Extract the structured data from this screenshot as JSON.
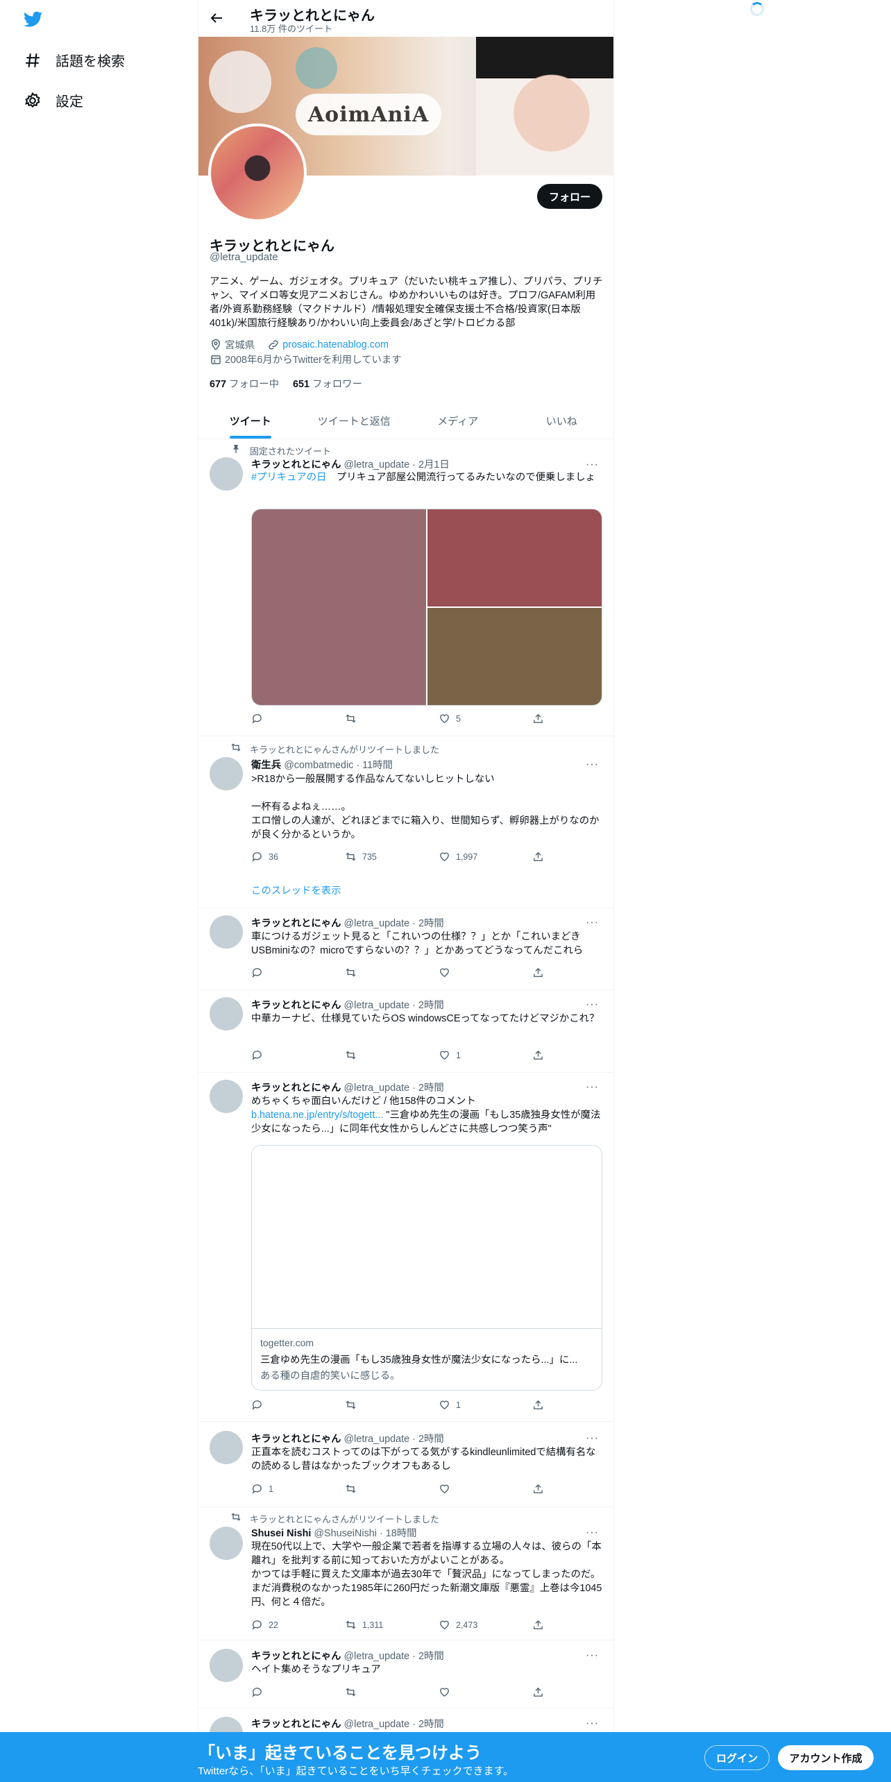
{
  "sidebar": {
    "items": [
      {
        "label": "話題を検索",
        "icon": "hashtag-icon"
      },
      {
        "label": "設定",
        "icon": "gear-icon"
      }
    ]
  },
  "header": {
    "name": "キラッとれとにゃん",
    "tweet_count": "11.8万 件のツイート"
  },
  "banner": {
    "logo_text": "AoimAniA"
  },
  "profile": {
    "follow_label": "フォロー",
    "name": "キラッとれとにゃん",
    "handle": "@letra_update",
    "bio": "アニメ、ゲーム、ガジェオタ。プリキュア（だいたい桃キュア推し）、プリパラ、プリチャン、マイメロ等女児アニメおじさん。ゆめかわいいものは好き。プロフ/GAFAM利用者/外資系勤務経験（マクドナルド）/情報処理安全確保支援士不合格/投資家(日本版401k)/米国旅行経験あり/かわいい向上委員会/あざと学/トロピカる部",
    "location": "宮城県",
    "url": "prosaic.hatenablog.com",
    "joined": "2008年6月からTwitterを利用しています",
    "following_count": "677",
    "following_label": "フォロー中",
    "followers_count": "651",
    "followers_label": "フォロワー"
  },
  "tabs": [
    {
      "label": "ツイート",
      "active": true
    },
    {
      "label": "ツイートと返信"
    },
    {
      "label": "メディア"
    },
    {
      "label": "いいね"
    }
  ],
  "tweets": [
    {
      "context": "固定されたツイート",
      "name": "キラッとれとにゃん",
      "handle": "@letra_update",
      "time": "2月1日",
      "hashtag": "#プリキュアの日",
      "text": "プリキュア部屋公開流行ってるみたいなので便乗しましょ",
      "reply": "",
      "retweet": "",
      "like": "5"
    },
    {
      "context": "キラッとれとにゃんさんがリツイートしました",
      "name": "衛生兵",
      "handle": "@combatmedic",
      "time": "11時間",
      "text": ">R18から一般展開する作品なんてないしヒットしない\n\n一杯有るよねぇ……。\nエロ憎しの人達が、どれほどまでに箱入り、世間知らず、孵卵器上がりなのかが良く分かるというか。",
      "reply": "36",
      "retweet": "735",
      "like": "1,997",
      "thread_link": "このスレッドを表示"
    },
    {
      "name": "キラッとれとにゃん",
      "handle": "@letra_update",
      "time": "2時間",
      "text": "車につけるガジェット見ると「これいつの仕様？？」とか「これいまどきUSBminiなの？microですらないの？？」とかあってどうなってんだこれら",
      "reply": "",
      "retweet": "",
      "like": ""
    },
    {
      "name": "キラッとれとにゃん",
      "handle": "@letra_update",
      "time": "2時間",
      "text": "中華カーナビ、仕様見ていたらOS windowsCEってなってたけどマジかこれ？",
      "reply": "",
      "retweet": "",
      "like": "1"
    },
    {
      "name": "キラッとれとにゃん",
      "handle": "@letra_update",
      "time": "2時間",
      "text_line1": "めちゃくちゃ面白いんだけど / 他158件のコメント",
      "link": "b.hatena.ne.jp/entry/s/togett...",
      "text_rest": " \"三倉ゆめ先生の漫画「もし35歳独身女性が魔法少女になったら...」に同年代女性からしんどさに共感しつつ笑う声\"",
      "card_domain": "togetter.com",
      "card_title": "三倉ゆめ先生の漫画「もし35歳独身女性が魔法少女になったら...」に...",
      "card_desc": "ある種の自虐的笑いに感じる。",
      "reply": "",
      "retweet": "",
      "like": "1"
    },
    {
      "name": "キラッとれとにゃん",
      "handle": "@letra_update",
      "time": "2時間",
      "text": "正直本を読むコストってのは下がってる気がするkindleunlimitedで結構有名なの読めるし昔はなかったブックオフもあるし",
      "reply": "1",
      "retweet": "",
      "like": ""
    },
    {
      "context": "キラッとれとにゃんさんがリツイートしました",
      "name": "Shusei Nishi",
      "handle": "@ShuseiNishi",
      "time": "18時間",
      "text": "現在50代以上で、大学や一般企業で若者を指導する立場の人々は、彼らの「本離れ」を批判する前に知っておいた方がよいことがある。\nかつては手軽に買えた文庫本が過去30年で「贅沢品」になってしまったのだ。まだ消費税のなかった1985年に260円だった新潮文庫版『悪霊』上巻は今1045円、何と４倍だ。",
      "reply": "22",
      "retweet": "1,311",
      "like": "2,473"
    },
    {
      "name": "キラッとれとにゃん",
      "handle": "@letra_update",
      "time": "2時間",
      "text": "ヘイト集めそうなプリキュア",
      "reply": "",
      "retweet": "",
      "like": ""
    },
    {
      "name": "キラッとれとにゃん",
      "handle": "@letra_update",
      "time": "2時間"
    }
  ],
  "bottom_bar": {
    "title": "「いま」起きていることを見つけよう",
    "subtitle": "Twitterなら、「いま」起きていることをいち早くチェックできます。",
    "login": "ログイン",
    "signup": "アカウント作成"
  },
  "colors": {
    "accent": "#1d9bf0",
    "text": "#0f1419",
    "muted": "#536471"
  }
}
